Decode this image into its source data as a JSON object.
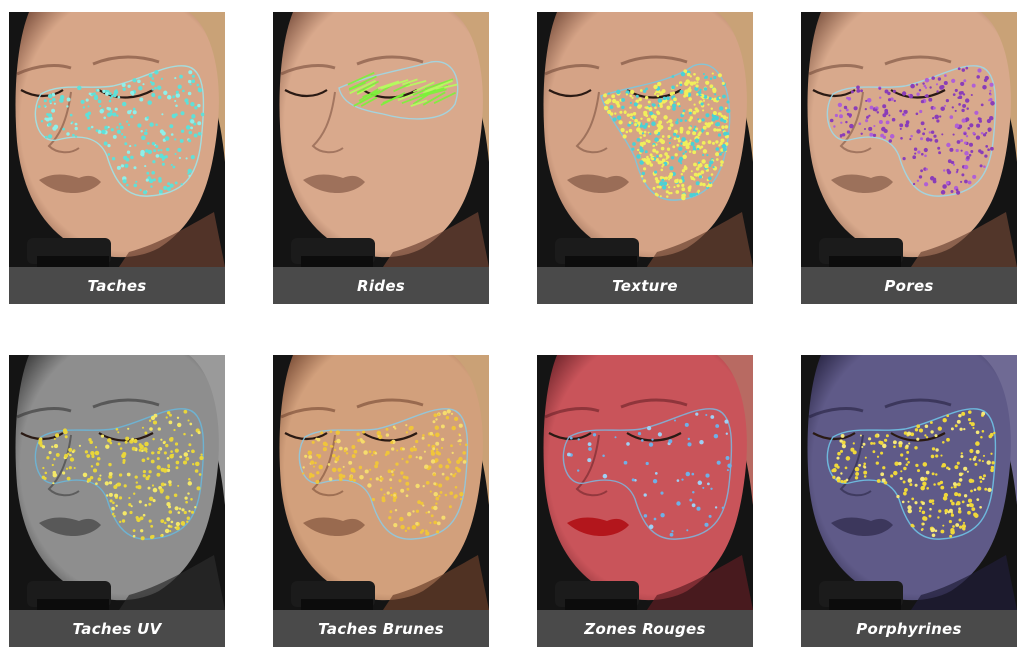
{
  "gallery": {
    "items": [
      {
        "label": "Taches",
        "skin": "#d7a688",
        "shadow": "#6b4030",
        "hair": "#c9a277",
        "dot": "#5fe0d8",
        "dot2": "#8ef0ea",
        "zone": "cheek-nose",
        "mode": "dots",
        "outline": "#9fe3e8"
      },
      {
        "label": "Rides",
        "skin": "#d9a98c",
        "shadow": "#6d4333",
        "hair": "#cba378",
        "dot": "#7cf23a",
        "dot2": "#b6ff5e",
        "zone": "eye",
        "mode": "lines",
        "outline": "#9fd7e6"
      },
      {
        "label": "Texture",
        "skin": "#d5a386",
        "shadow": "#6a4131",
        "hair": "#c9a277",
        "dot": "#f1ef5c",
        "dot2": "#4ad1d6",
        "zone": "cheek",
        "mode": "dense",
        "outline": "#7ac8e0"
      },
      {
        "label": "Pores",
        "skin": "#d8a98c",
        "shadow": "#6c4433",
        "hair": "#c9a277",
        "dot": "#8a3db8",
        "dot2": "#b05fd6",
        "zone": "cheek-nose",
        "mode": "dots",
        "outline": "#9fd7e6"
      },
      {
        "label": "Taches UV",
        "skin": "#8e8e8e",
        "shadow": "#2b2b2b",
        "hair": "#9a9a9a",
        "dot": "#e9d63a",
        "dot2": "#f4e868",
        "zone": "cheek-nose",
        "mode": "dots",
        "outline": "#6ab6d8"
      },
      {
        "label": "Taches Brunes",
        "skin": "#d2a07c",
        "shadow": "#6a3e2a",
        "hair": "#caa176",
        "dot": "#f0c53a",
        "dot2": "#f6dc6e",
        "zone": "cheek-nose",
        "mode": "dots",
        "outline": "#8fc9e0"
      },
      {
        "label": "Zones Rouges",
        "skin": "#c9545a",
        "shadow": "#5e1c22",
        "hair": "#b86a62",
        "dot": "#6fb0e6",
        "dot2": "#9fd0f4",
        "zone": "cheek-nose",
        "mode": "sparse",
        "outline": "#7fb3d8"
      },
      {
        "label": "Porphyrines",
        "skin": "#5f5a88",
        "shadow": "#1f1c38",
        "hair": "#6f6a94",
        "dot": "#f0d83a",
        "dot2": "#f6e878",
        "zone": "cheek-nose",
        "mode": "dots",
        "outline": "#6fc2e6"
      }
    ]
  }
}
